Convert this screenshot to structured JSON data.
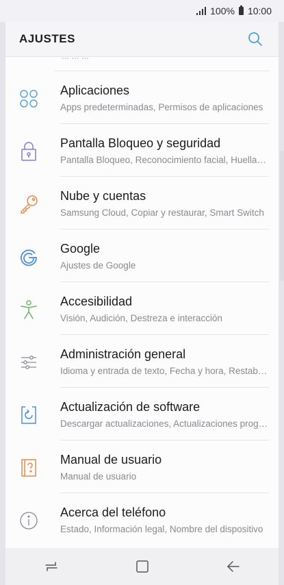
{
  "status": {
    "battery": "100%",
    "time": "10:00"
  },
  "header": {
    "title": "AJUSTES"
  },
  "list": {
    "partial_text": "...  ...  ...",
    "items": [
      {
        "label": "Aplicaciones",
        "sub": "Apps predeterminadas, Permisos de aplicaciones",
        "icon": "apps-icon",
        "color": "#5aa3d8"
      },
      {
        "label": "Pantalla Bloqueo y seguridad",
        "sub": "Pantalla Bloqueo, Reconocimiento facial, Huellas digitales",
        "icon": "lock-icon",
        "color": "#8a78d6"
      },
      {
        "label": "Nube y cuentas",
        "sub": "Samsung Cloud, Copiar y restaurar, Smart Switch",
        "icon": "key-icon",
        "color": "#e8894a"
      },
      {
        "label": "Google",
        "sub": "Ajustes de Google",
        "icon": "google-icon",
        "color": "#4a8fd8"
      },
      {
        "label": "Accesibilidad",
        "sub": "Visión, Audición, Destreza e interacción",
        "icon": "accessibility-icon",
        "color": "#6bb56a"
      },
      {
        "label": "Administración general",
        "sub": "Idioma y entrada de texto, Fecha y hora, Restablecer",
        "icon": "sliders-icon",
        "color": "#8a8a92"
      },
      {
        "label": "Actualización de software",
        "sub": "Descargar actualizaciones, Actualizaciones programadas",
        "icon": "software-update-icon",
        "color": "#4a8fd8"
      },
      {
        "label": "Manual de usuario",
        "sub": "Manual de usuario",
        "icon": "manual-icon",
        "color": "#e8894a"
      },
      {
        "label": "Acerca del teléfono",
        "sub": "Estado, Información legal, Nombre del dispositivo",
        "icon": "info-icon",
        "color": "#8a8a92"
      }
    ]
  }
}
